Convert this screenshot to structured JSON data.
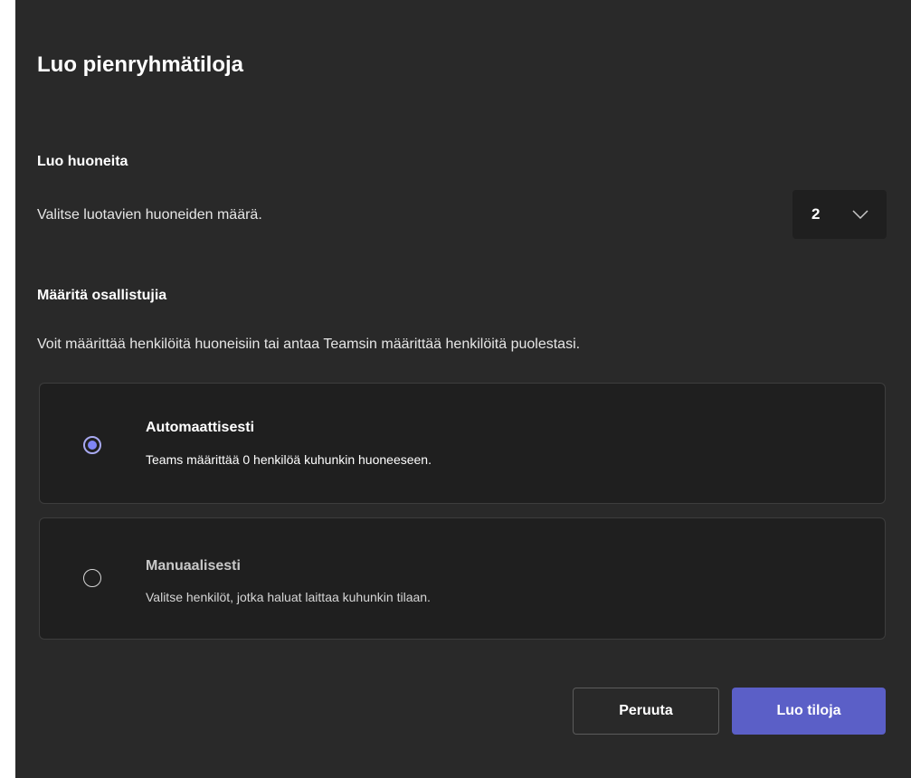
{
  "dialog": {
    "title": "Luo pienryhmätiloja"
  },
  "create_rooms": {
    "heading": "Luo huoneita",
    "description": "Valitse luotavien huoneiden määrä.",
    "room_count": "2",
    "dropdown_icon": "chevron-down-icon"
  },
  "assign_participants": {
    "heading": "Määritä osallistujia",
    "description": "Voit määrittää henkilöitä huoneisiin tai antaa Teamsin määrittää henkilöitä puolestasi.",
    "options": [
      {
        "title": "Automaattisesti",
        "description": "Teams määrittää 0 henkilöä kuhunkin huoneeseen.",
        "selected": true
      },
      {
        "title": "Manuaalisesti",
        "description": "Valitse henkilöt, jotka haluat laittaa kuhunkin tilaan.",
        "selected": false
      }
    ]
  },
  "footer": {
    "cancel_label": "Peruuta",
    "create_label": "Luo tiloja"
  },
  "colors": {
    "dialog_background": "#292929",
    "card_background": "#1f1f1f",
    "accent": "#5b5fc7",
    "radio_selected": "#7f85f5"
  }
}
